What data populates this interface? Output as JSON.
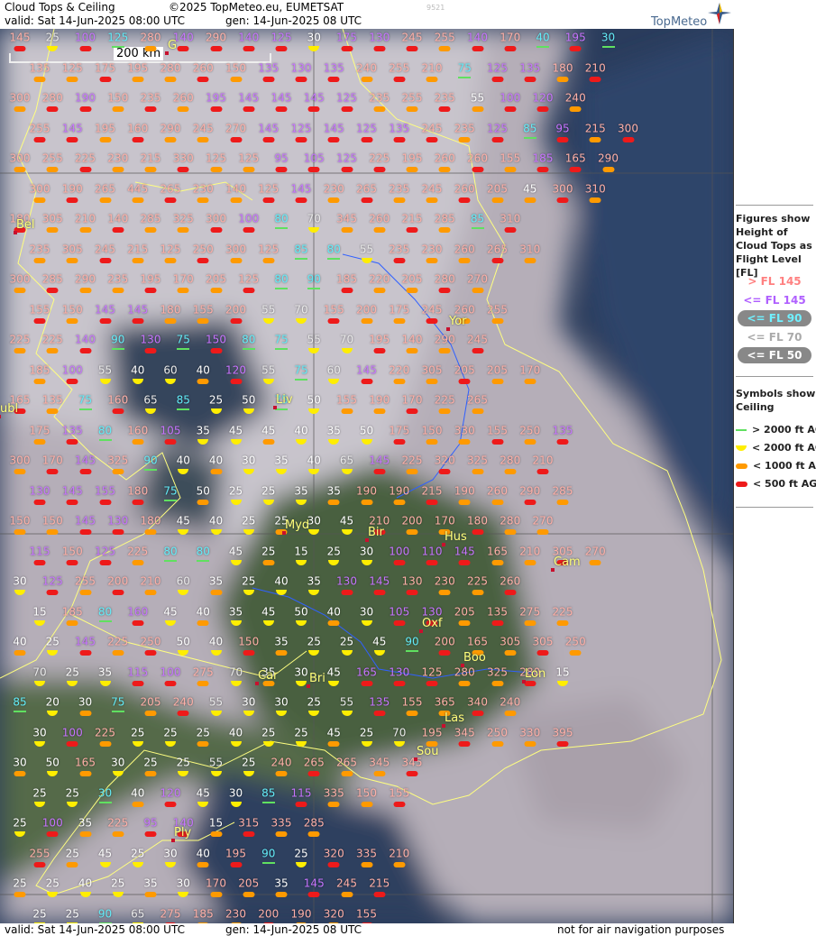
{
  "header": {
    "title": "Cloud Tops & Ceiling",
    "copyright": "©2025 TopMeteo.eu, EUMETSAT",
    "valid": "valid:  Sat  14-Jun-2025  08:00 UTC",
    "generated": "gen: 14-Jun-2025 08 UTC",
    "code": "9521",
    "brand": "TopMeteo"
  },
  "scale": {
    "label": "200 km"
  },
  "legend": {
    "figures_title": "Figures show Height of Cloud Tops as Flight Level  [FL]",
    "fl_items": [
      {
        "text": "> FL 145",
        "color": "#ff8080"
      },
      {
        "text": "<= FL 145",
        "color": "#b060ff"
      },
      {
        "text": "<= FL 90",
        "color": "#70f0ff"
      },
      {
        "text": "<= FL 70",
        "color": "#aaaaaa"
      },
      {
        "text": "<= FL 50",
        "color": "#ffffff"
      }
    ],
    "symbols_title": "Symbols show Ceiling",
    "symbol_items": [
      {
        "text": "> 2000 ft AGL",
        "symbol": "green-line"
      },
      {
        "text": "< 2000 ft AGL",
        "symbol": "yellow-half-circle"
      },
      {
        "text": "< 1000 ft AGL",
        "symbol": "orange-bar"
      },
      {
        "text": "< 500 ft AGL",
        "symbol": "red-bar"
      }
    ]
  },
  "footer": {
    "valid": "valid:  Sat  14-Jun-2025  08:00 UTC",
    "generated": "gen: 14-Jun-2025 08 UTC",
    "disclaimer": "not for air navigation purposes"
  },
  "cities": [
    "G",
    "Bel",
    "Yor",
    "Liv",
    "ubl",
    "Myd",
    "Bir",
    "Hus",
    "Cam",
    "Oxf",
    "Boo",
    "Car",
    "Bri",
    "Lon",
    "Las",
    "Sou",
    "Ply"
  ],
  "grid": {
    "rows": [
      "145a 25d 100b 125c 280a 140b 290a 140b 125b 30e 175b 130b 245a 255a 140b 170a 40c 195b 30c",
      "135a 125a 175a 195a 280a 260a 150a 135b 130b 135b 240a 255a 210a 75c 125b 135b 180a 210a",
      "300a 280a 190b 150a 235a 260a 195b 145b 145b 145b 125b 235a 255a 235a 55e 100b 120b 240a",
      "255a 145b 195a 160a 290a 245a 270a 145b 125b 145b 125b 135b 245a 235a 125b 85c 95b 215a 300a",
      "300a 255a 225a 230a 215a 330a 125a 125a 95b 105b 125b 225a 195a 260a 260a 155a 185b 165a 290a",
      "300a 190a 265a 445a 265a 230a 140a 125a 145b 230a 265a 235a 245a 260a 205a 45e 300a 310a",
      "180a 305a 210a 140a 285a 325a 300a 100b 80c 70d 345a 260a 215a 285a 85c 310a",
      "235a 305a 245a 215a 125a 250a 300a 125a 85c 80c 55d 235a 230a 260a 265a 310a",
      "300a 285a 290a 235a 195a 170a 205a 125a 80c 90c 185a 220a 205a 280a 270a",
      "155a 150a 145b 145b 180a 155a 200a 55d 70d 155a 200a 175a 245a 260a 255a",
      "225a 225a 140b 90c 130b 75c 150b 80c 75c 55d 70d 195a 140a 290a 245a",
      "185a 100b 55d 40e 60d 40e 120b 55d 75c 60d 145b 220a 305a 205a 205a 170a",
      "165a 135a 75c 160a 65d 85c 25e 50e 75c 50e 155a 190a 170a 225a 265a",
      "175a 135b 80c 160a 105b 35e 45e 45e 40e 35e 50e 175a 150a 330a 155a 250a 135b",
      "300a 170a 145b 325a 90c 40e 40e 30e 35e 40e 65d 145b 225a 320a 325a 280a 210a",
      "130b 145b 155b 180a 75c 50e 25e 25e 35e 35e 190a 190a 215a 190a 260a 290a 285a",
      "150a 150a 145b 130b 180a 45e 40e 25e 25e 30e 45e 210a 200a 170a 180a 280a 270a",
      "115b 150a 125b 225a 80c 80c 45e 25e 15e 25e 30e 100b 110b 145b 165a 210a 305a 270a",
      "30e 125b 255a 200a 210a 60d 35e 25e 40e 35e 130b 145b 130a 230a 225a 260a",
      "15e 185a 80c 160b 45e 40e 35e 45e 50e 40e 30e 105b 130b 205a 135a 275a 225a",
      "40e 25e 145b 225a 250a 50e 40e 150a 35e 25e 25e 45e 90c 200a 165a 305a 305a 250a",
      "70d 25e 35e 115b 100b 275a 70d 35e 30e 45e 165b 130b 125a 280a 325a 280a 15e",
      "85c 20e 30e 75c 205a 240a 55d 30e 30e 25e 55d 135b 155a 365a 340a 240a",
      "30e 100b 225a 25e 25e 25e 40e 25e 25e 45e 25e 70d 195a 345a 250a 330a 395a",
      "30e 50e 165a 30e 25e 25e 55d 25e 240a 265a 265a 345a 345a",
      "25e 25e 30c 40e 120b 45e 30e 85c 115b 335a 150a 155a",
      "25e 100b 35e 225a 95b 140b 15e 315a 335a 285a",
      "255a 25e 45e 25e 30e 40e 195a 90c 25e 320a 335a 210a",
      "25e 25e 40e 25e 35e 30e 170a 205a 35e 145b 245a 215a",
      "25e 25e 90c 65d 275a 185a 230a 200a 190a 320a 155a"
    ]
  }
}
